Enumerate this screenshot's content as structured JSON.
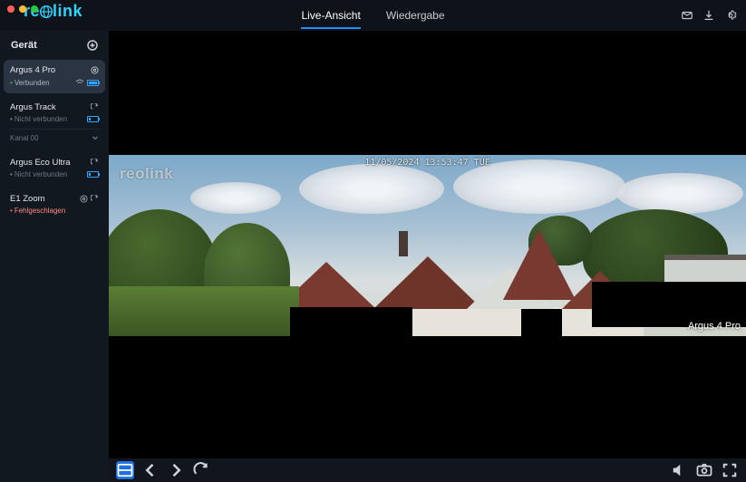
{
  "brand": {
    "seg1": "re",
    "seg3": "link"
  },
  "tabs": {
    "live": "Live-Ansicht",
    "playback": "Wiedergabe"
  },
  "sidebar": {
    "title": "Gerät",
    "devices": [
      {
        "name": "Argus 4 Pro",
        "status_label": "Verbunden",
        "status": "ok"
      },
      {
        "name": "Argus Track",
        "status_label": "Nicht verbunden",
        "status": "bad",
        "channel": "Kanal 00"
      },
      {
        "name": "Argus Eco Ultra",
        "status_label": "Nicht verbunden",
        "status": "bad"
      },
      {
        "name": "E1 Zoom",
        "status_label": "Fehlgeschlagen",
        "status": "err"
      }
    ]
  },
  "feed": {
    "watermark": "reolink",
    "timestamp": "11/05/2024 13:53:47 TUE",
    "camera_label": "Argus 4 Pro"
  }
}
